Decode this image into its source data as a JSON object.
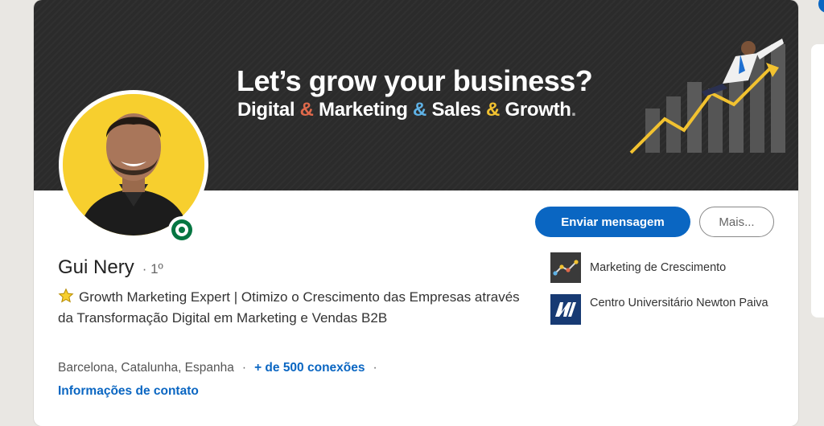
{
  "banner": {
    "title": "Let’s grow your business?",
    "subtitle_parts": [
      "Digital ",
      "& ",
      "Marketing ",
      "& ",
      "Sales ",
      "& ",
      "Growth",
      "."
    ],
    "amp_colors": [
      "#e0694b",
      "#5fb2e6",
      "#f2c230"
    ]
  },
  "profile": {
    "name": "Gui Nery",
    "degree": "· 1º",
    "headline": "Growth Marketing Expert | Otimizo o Crescimento das Empresas através da Transformação Digital em Marketing e Vendas B2B",
    "location": "Barcelona, Catalunha, Espanha",
    "dot": "·",
    "connections": "+ de 500 conexões",
    "contact_info": "Informações de contato"
  },
  "actions": {
    "message_label": "Enviar mensagem",
    "more_label": "Mais..."
  },
  "organizations": [
    {
      "name": "Marketing de Crescimento",
      "icon": "chart-line-icon"
    },
    {
      "name": "Centro Universitário Newton Paiva",
      "icon": "nm-logo-icon"
    }
  ],
  "colors": {
    "brand_blue": "#0a66c2",
    "online_green": "#057642",
    "banner_dark": "#2b2b2b",
    "avatar_bg": "#f7cf2e"
  }
}
